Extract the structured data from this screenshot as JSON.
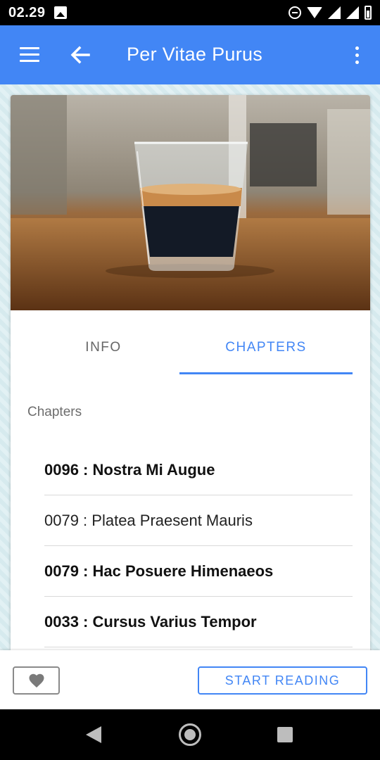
{
  "status_bar": {
    "time": "02.29"
  },
  "app_bar": {
    "title": "Per Vitae Purus"
  },
  "tabs": [
    {
      "label": "INFO",
      "active": false
    },
    {
      "label": "CHAPTERS",
      "active": true
    }
  ],
  "section_label": "Chapters",
  "chapters": [
    {
      "title": "0096 : Nostra Mi Augue",
      "bold": true
    },
    {
      "title": "0079 : Platea Praesent Mauris",
      "bold": false
    },
    {
      "title": "0079 : Hac Posuere Himenaeos",
      "bold": true
    },
    {
      "title": "0033 : Cursus Varius Tempor",
      "bold": true
    }
  ],
  "actions": {
    "start_reading": "START READING"
  },
  "colors": {
    "accent": "#4286f5",
    "status_bar": "#000000"
  }
}
